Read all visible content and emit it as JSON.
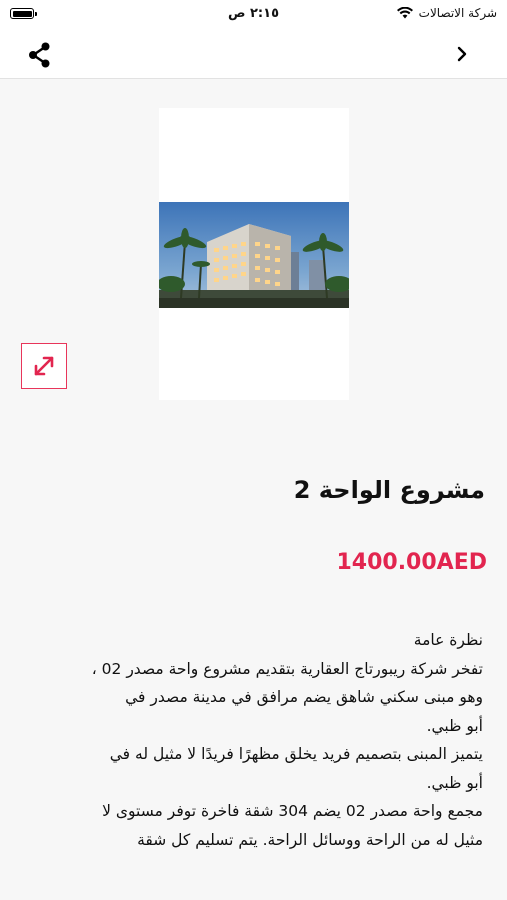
{
  "status_bar": {
    "carrier": "شركة الاتصالات",
    "time": "٢:١٥ ص"
  },
  "nav": {
    "share_icon": "share-icon",
    "back_icon": "chevron-right-icon"
  },
  "product": {
    "title": "مشروع الواحة 2",
    "price": "1400.00AED",
    "description_lines": [
      "نظرة عامة",
      "تفخر شركة ريبورتاج العقارية بتقديم مشروع واحة مصدر 02 ،",
      "وهو مبنى سكني شاهق يضم مرافق في مدينة مصدر في",
      "أبو ظبي.",
      "يتميز المبنى بتصميم فريد يخلق مظهرًا فريدًا لا مثيل له في",
      "أبو ظبي.",
      "مجمع واحة مصدر 02 يضم 304 شقة فاخرة توفر مستوى لا",
      "مثيل له من الراحة ووسائل الراحة. يتم تسليم كل شقة"
    ]
  },
  "colors": {
    "accent": "#e2254f",
    "background": "#f7f7f7"
  }
}
